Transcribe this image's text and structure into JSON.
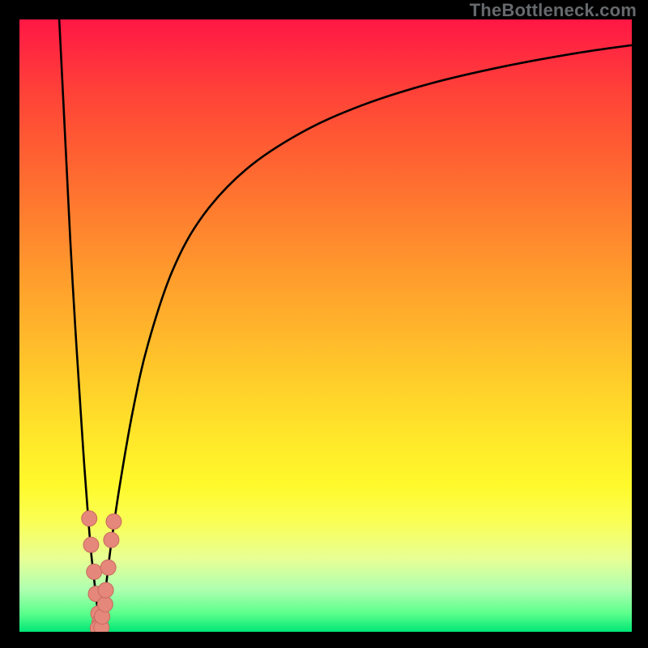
{
  "watermark": "TheBottleneck.com",
  "colors": {
    "frame": "#000000",
    "curve": "#000000",
    "dot_fill": "#e5877a",
    "dot_stroke": "#c76a5e",
    "gradient_top": "#ff1744",
    "gradient_bottom": "#00e676"
  },
  "chart_data": {
    "type": "line",
    "title": "",
    "xlabel": "",
    "ylabel": "",
    "xlim": [
      0,
      100
    ],
    "ylim": [
      0,
      100
    ],
    "grid": false,
    "legend": false,
    "series": [
      {
        "name": "left-branch",
        "x": [
          6.5,
          7.0,
          7.6,
          8.3,
          9.1,
          10.0,
          10.6,
          11.2,
          11.7,
          12.2,
          12.6,
          12.9,
          13.1,
          13.2
        ],
        "y": [
          100,
          90,
          78,
          64,
          50,
          36,
          27,
          19,
          13,
          8.5,
          5.0,
          2.5,
          1.0,
          0.0
        ]
      },
      {
        "name": "right-branch",
        "x": [
          13.2,
          13.6,
          14.2,
          15.0,
          16.4,
          18.5,
          21,
          25,
          30,
          37,
          46,
          56,
          67,
          79,
          91,
          100
        ],
        "y": [
          0.0,
          3.0,
          8.0,
          14.5,
          24,
          36,
          47,
          59,
          68,
          75.5,
          81.5,
          86,
          89.5,
          92.3,
          94.5,
          95.8
        ]
      }
    ],
    "scatter": {
      "name": "markers",
      "points": [
        {
          "x": 11.4,
          "y": 18.5
        },
        {
          "x": 11.7,
          "y": 14.2
        },
        {
          "x": 12.2,
          "y": 9.8
        },
        {
          "x": 12.5,
          "y": 6.2
        },
        {
          "x": 12.9,
          "y": 3.0
        },
        {
          "x": 13.1,
          "y": 1.6
        },
        {
          "x": 13.0,
          "y": 0.9
        },
        {
          "x": 12.8,
          "y": 0.6
        },
        {
          "x": 13.4,
          "y": 0.7
        },
        {
          "x": 13.5,
          "y": 2.5
        },
        {
          "x": 14.0,
          "y": 4.5
        },
        {
          "x": 14.1,
          "y": 6.8
        },
        {
          "x": 14.5,
          "y": 10.5
        },
        {
          "x": 15.0,
          "y": 15.0
        },
        {
          "x": 15.4,
          "y": 18.0
        }
      ]
    }
  }
}
